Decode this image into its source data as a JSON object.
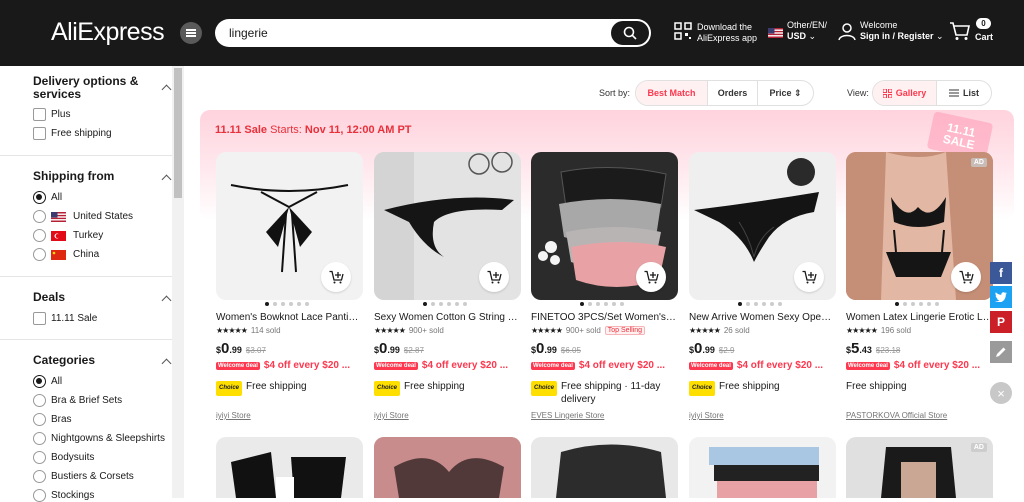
{
  "header": {
    "logo": "AliExpress",
    "search_value": "lingerie",
    "app_line1": "Download the",
    "app_line2": "AliExpress app",
    "locale_line1": "Other/EN/",
    "locale_line2": "USD",
    "welcome_line1": "Welcome",
    "welcome_line2": "Sign in / Register",
    "cart_count": "0",
    "cart_label": "Cart"
  },
  "sidebar": {
    "delivery_title_1": "Delivery options &",
    "delivery_title_2": "services",
    "delivery_opts": [
      "Plus",
      "Free shipping"
    ],
    "shipping_title": "Shipping from",
    "shipping_opts": [
      "All",
      "United States",
      "Turkey",
      "China"
    ],
    "deals_title": "Deals",
    "deals_opts": [
      "11.11 Sale"
    ],
    "categories_title": "Categories",
    "category_opts": [
      "All",
      "Bra & Brief Sets",
      "Bras",
      "Nightgowns & Sleepshirts",
      "Bodysuits",
      "Bustiers & Corsets",
      "Stockings"
    ]
  },
  "sortbar": {
    "sort_label": "Sort by:",
    "best_match": "Best Match",
    "orders": "Orders",
    "price": "Price",
    "view_label": "View:",
    "gallery": "Gallery",
    "list": "List"
  },
  "banner": {
    "sale": "11.11 Sale",
    "starts": "Starts:",
    "date": "Nov 11, 12:00 AM PT",
    "badge_line1": "11.11",
    "badge_line2": "SALE"
  },
  "products": [
    {
      "title": "Women's Bowknot Lace Panties...",
      "stars": "★★★★★",
      "sold": "114 sold",
      "currency": "$",
      "price": "0",
      "cents": ".99",
      "old": "$3.07",
      "deal_tag": "Welcome deal",
      "deal": "$4 off every $20 ...",
      "choice": "Choice",
      "ship": "Free shipping",
      "ship2": "",
      "store": "iyiyi Store",
      "ad": "",
      "top": ""
    },
    {
      "title": "Sexy Women Cotton G String Th...",
      "stars": "★★★★★",
      "sold": "900+ sold",
      "currency": "$",
      "price": "0",
      "cents": ".99",
      "old": "$2.87",
      "deal_tag": "Welcome deal",
      "deal": "$4 off every $20 ...",
      "choice": "Choice",
      "ship": "Free shipping",
      "ship2": "",
      "store": "iyiyi Store",
      "ad": "",
      "top": ""
    },
    {
      "title": "FINETOO 3PCS/Set Women's Un...",
      "stars": "★★★★★",
      "sold": "900+ sold",
      "currency": "$",
      "price": "0",
      "cents": ".99",
      "old": "$6.05",
      "deal_tag": "Welcome deal",
      "deal": "$4 off every $20 ...",
      "choice": "Choice",
      "ship": "Free shipping · 11-day",
      "ship2": "delivery",
      "store": "EVES Lingerie Store",
      "ad": "",
      "top": "Top Selling"
    },
    {
      "title": "New Arrive Women Sexy Openi...",
      "stars": "★★★★★",
      "sold": "26 sold",
      "currency": "$",
      "price": "0",
      "cents": ".99",
      "old": "$2.9",
      "deal_tag": "Welcome deal",
      "deal": "$4 off every $20 ...",
      "choice": "Choice",
      "ship": "Free shipping",
      "ship2": "",
      "store": "iyiyi Store",
      "ad": "",
      "top": ""
    },
    {
      "title": "Women Latex Lingerie Erotic Le...",
      "stars": "★★★★★",
      "sold": "196 sold",
      "currency": "$",
      "price": "5",
      "cents": ".43",
      "old": "$23.18",
      "deal_tag": "Welcome deal",
      "deal": "$4 off every $20 ...",
      "choice": "",
      "ship": "Free shipping",
      "ship2": "",
      "store": "PASTORKOVA Official Store",
      "ad": "AD",
      "top": ""
    }
  ],
  "row2_ad": "AD",
  "colors": {
    "accent": "#e8313b",
    "header_bg": "#191919",
    "choice": "#ffdf00"
  }
}
